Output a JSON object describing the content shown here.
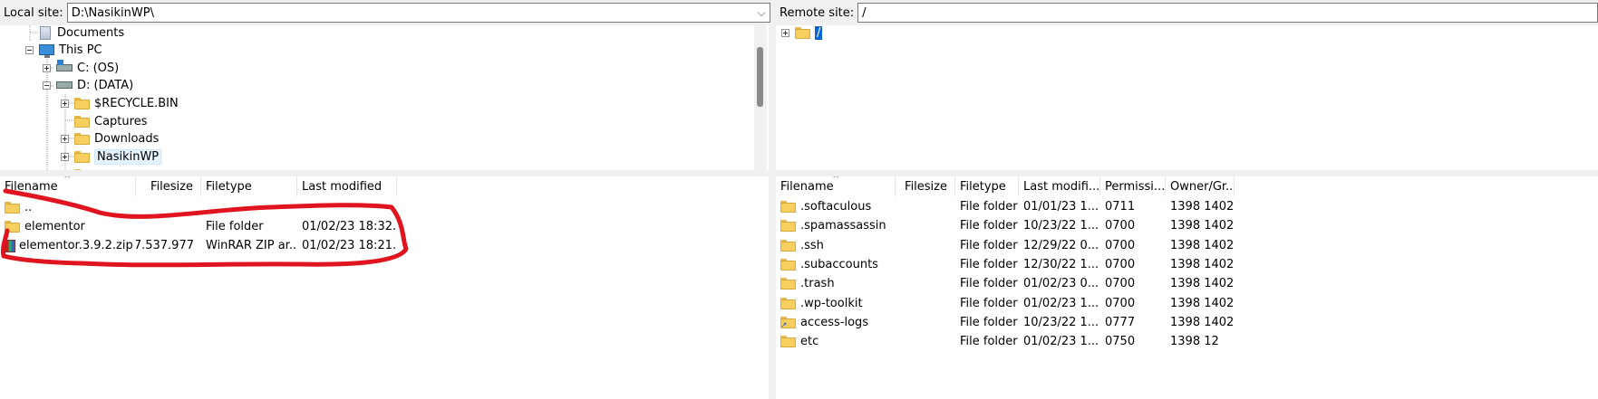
{
  "local": {
    "site_label": "Local site:",
    "site_path": "D:\\NasikinWP\\",
    "tree": [
      {
        "label": "Documents"
      },
      {
        "label": "This PC"
      },
      {
        "label": "C: (OS)"
      },
      {
        "label": "D: (DATA)"
      },
      {
        "label": "$RECYCLE.BIN"
      },
      {
        "label": "Captures"
      },
      {
        "label": "Downloads"
      },
      {
        "label": "NasikinWP"
      }
    ],
    "columns": [
      "Filename",
      "Filesize",
      "Filetype",
      "Last modified"
    ],
    "files": [
      {
        "name": "..",
        "size": "",
        "type": "",
        "modified": ""
      },
      {
        "name": "elementor",
        "size": "",
        "type": "File folder",
        "modified": "01/02/23 18:32..."
      },
      {
        "name": "elementor.3.9.2.zip",
        "size": "7.537.977",
        "type": "WinRAR ZIP ar...",
        "modified": "01/02/23 18:21..."
      }
    ]
  },
  "remote": {
    "site_label": "Remote site:",
    "site_path": "/",
    "tree": [
      {
        "label": "/"
      }
    ],
    "columns": [
      "Filename",
      "Filesize",
      "Filetype",
      "Last modifi...",
      "Permissi...",
      "Owner/Gr..."
    ],
    "files": [
      {
        "name": ".softaculous",
        "size": "",
        "type": "File folder",
        "modified": "01/01/23 1...",
        "perms": "0711",
        "owner": "1398 1402"
      },
      {
        "name": ".spamassassin",
        "size": "",
        "type": "File folder",
        "modified": "10/23/22 1...",
        "perms": "0700",
        "owner": "1398 1402"
      },
      {
        "name": ".ssh",
        "size": "",
        "type": "File folder",
        "modified": "12/29/22 0...",
        "perms": "0700",
        "owner": "1398 1402"
      },
      {
        "name": ".subaccounts",
        "size": "",
        "type": "File folder",
        "modified": "12/30/22 1...",
        "perms": "0700",
        "owner": "1398 1402"
      },
      {
        "name": ".trash",
        "size": "",
        "type": "File folder",
        "modified": "01/02/23 0...",
        "perms": "0700",
        "owner": "1398 1402"
      },
      {
        "name": ".wp-toolkit",
        "size": "",
        "type": "File folder",
        "modified": "01/02/23 1...",
        "perms": "0700",
        "owner": "1398 1402"
      },
      {
        "name": "access-logs",
        "size": "",
        "type": "File folder",
        "modified": "10/23/22 1...",
        "perms": "0777",
        "owner": "1398 1402"
      },
      {
        "name": "etc",
        "size": "",
        "type": "File folder",
        "modified": "01/02/23 1...",
        "perms": "0750",
        "owner": "1398 12"
      }
    ]
  },
  "annotation": {
    "color": "#e0141e"
  }
}
